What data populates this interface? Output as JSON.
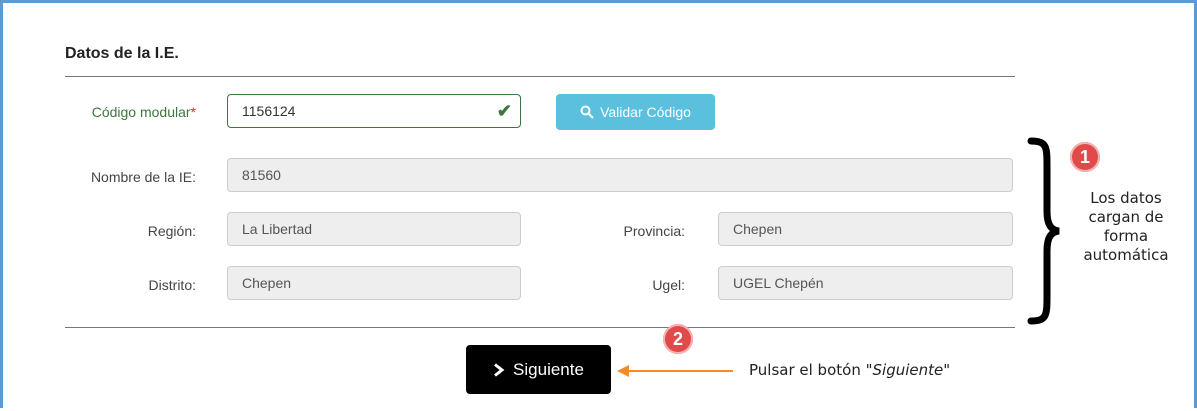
{
  "section": {
    "title": "Datos de la I.E."
  },
  "codigo": {
    "label": "Código modular",
    "required_mark": "*",
    "value": "1156124"
  },
  "validate_button": {
    "label": "Validar Código"
  },
  "nombre": {
    "label": "Nombre de la IE:",
    "value": "81560"
  },
  "region": {
    "label": "Región:",
    "value": "La Libertad"
  },
  "provincia": {
    "label": "Provincia:",
    "value": "Chepen"
  },
  "distrito": {
    "label": "Distrito:",
    "value": "Chepen"
  },
  "ugel": {
    "label": "Ugel:",
    "value": "UGEL Chepén"
  },
  "next_button": {
    "label": "Siguiente"
  },
  "annotation1": {
    "number": "1",
    "lines": [
      "Los datos",
      "cargan de",
      "forma",
      "automática"
    ]
  },
  "annotation2": {
    "number": "2",
    "text_prefix": "Pulsar el botón ",
    "text_emph": "\"Siguiente\""
  },
  "colors": {
    "frame": "#5b9bd5",
    "valid": "#3c763d",
    "info_button": "#5bc0de",
    "badge": "#e04a4a",
    "arrow": "#f28c28"
  }
}
